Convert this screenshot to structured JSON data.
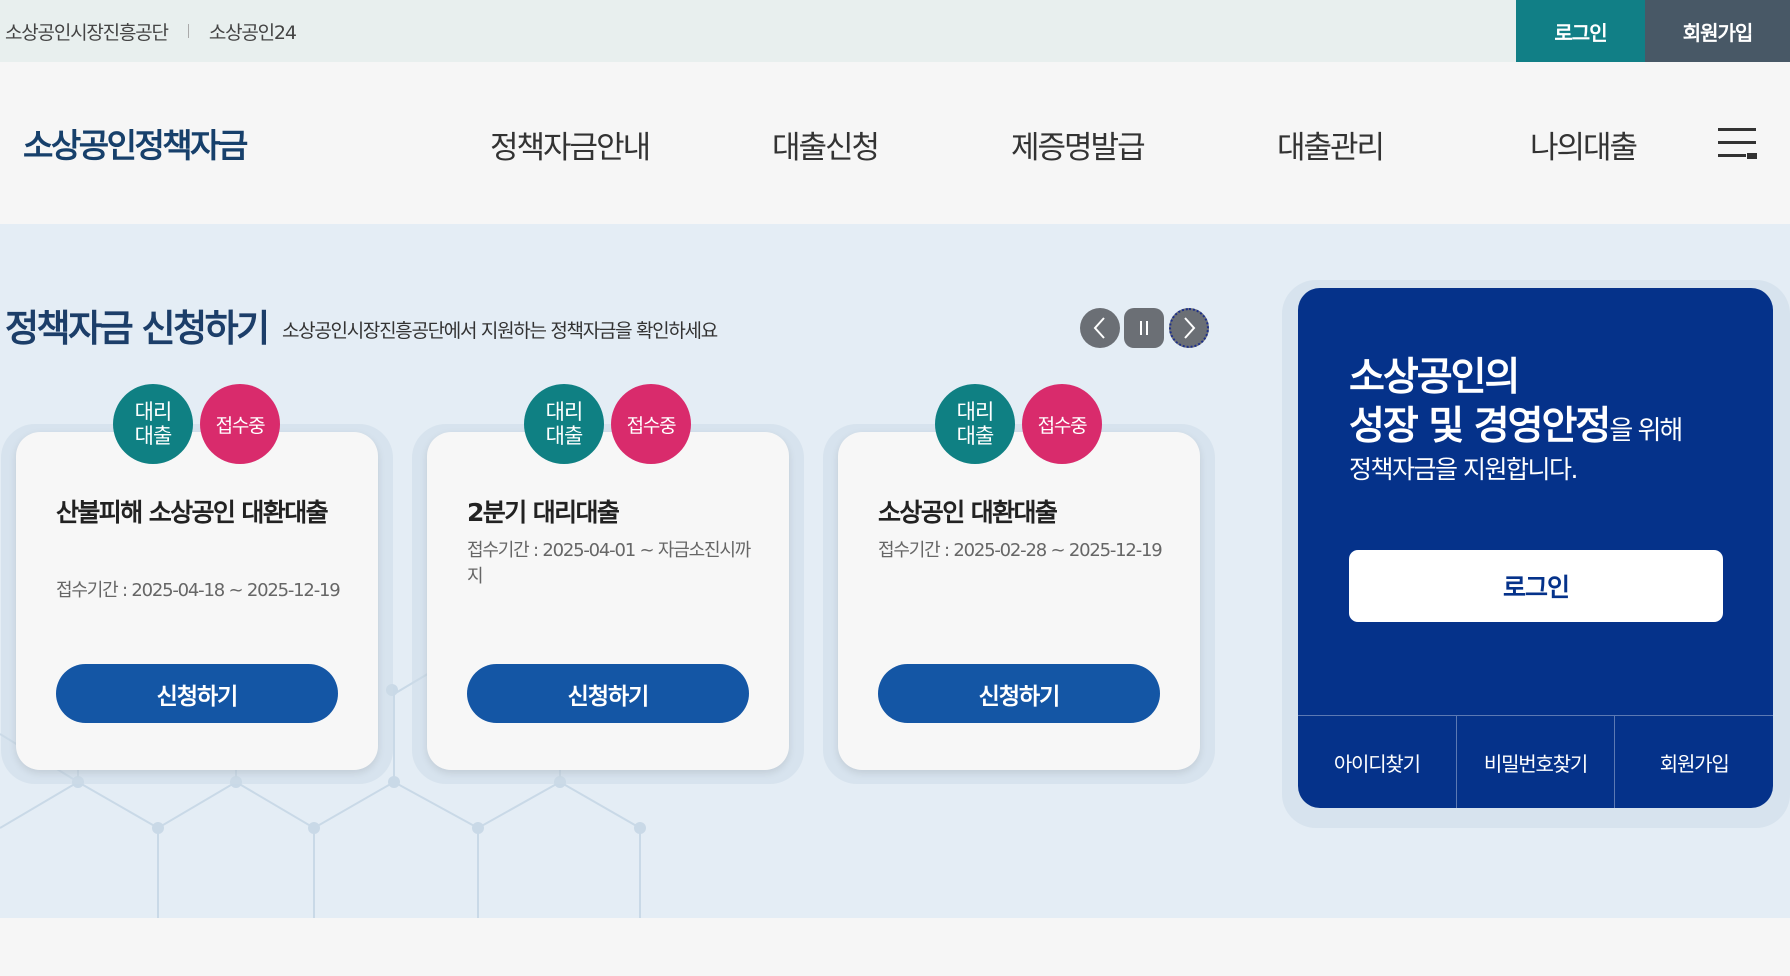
{
  "topbar": {
    "links": [
      "소상공인시장진흥공단",
      "소상공인24"
    ],
    "login_label": "로그인",
    "join_label": "회원가입"
  },
  "header": {
    "logo": "소상공인정책자금",
    "nav": [
      "정책자금안내",
      "대출신청",
      "제증명발급",
      "대출관리",
      "나의대출"
    ],
    "menu_icon": "hamburger-menu-icon"
  },
  "section": {
    "title": "정책자금 신청하기",
    "subtitle": "소상공인시장진흥공단에서 지원하는 정책자금을 확인하세요",
    "controls": [
      "prev-arrow-icon",
      "pause-icon",
      "next-arrow-icon"
    ]
  },
  "cards": [
    {
      "badge_type": "대리\n대출",
      "badge_type_lines": [
        "대리",
        "대출"
      ],
      "status": "접수중",
      "title": "산불피해 소상공인 대환대출",
      "period": "접수기간 : 2025-04-18 ~ 2025-12-19",
      "button": "신청하기"
    },
    {
      "badge_type_lines": [
        "대리",
        "대출"
      ],
      "status": "접수중",
      "title": "2분기 대리대출",
      "period": "접수기간 : 2025-04-01 ~ 자금소진시까지",
      "button": "신청하기"
    },
    {
      "badge_type_lines": [
        "대리",
        "대출"
      ],
      "status": "접수중",
      "title": "소상공인 대환대출",
      "period": "접수기간 : 2025-02-28 ~ 2025-12-19",
      "button": "신청하기"
    }
  ],
  "panel": {
    "line1": "소상공인의",
    "line2_strong": "성장 및 경영안정",
    "line2_rest": "을 위해",
    "line3": "정책자금을 지원합니다.",
    "login_button": "로그인",
    "links": [
      "아이디찾기",
      "비밀번호찾기",
      "회원가입"
    ]
  },
  "colors": {
    "teal": "#117f86",
    "navy": "#05328a",
    "button_blue": "#1456a5",
    "badge_teal": "#0f8083",
    "badge_pink": "#d92b6c",
    "title_navy": "#1c3e69"
  }
}
